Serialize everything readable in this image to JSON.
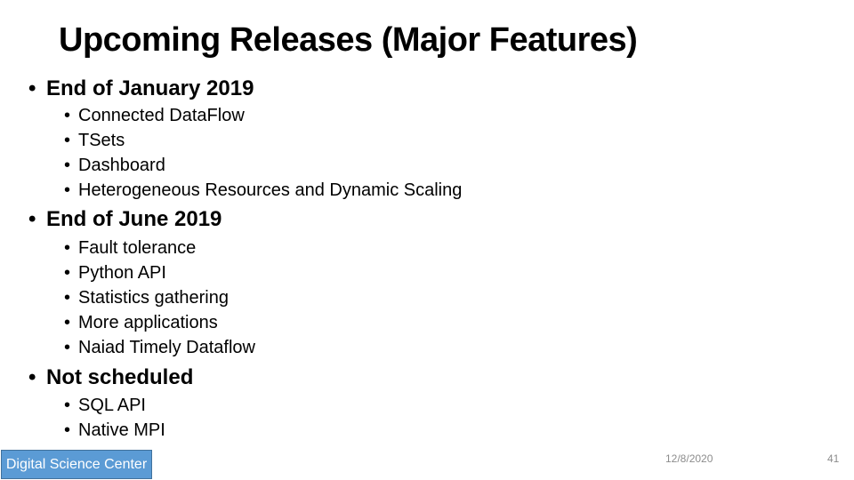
{
  "slide": {
    "title": "Upcoming Releases (Major Features)",
    "sections": [
      {
        "heading": "End of January 2019",
        "items": [
          "Connected DataFlow",
          "TSets",
          "Dashboard",
          "Heterogeneous Resources and Dynamic Scaling"
        ]
      },
      {
        "heading": "End of June 2019",
        "items": [
          "Fault tolerance",
          "Python API",
          "Statistics gathering",
          "More applications",
          "Naiad Timely Dataflow"
        ]
      },
      {
        "heading": "Not scheduled",
        "items": [
          "SQL API",
          "Native MPI"
        ]
      }
    ],
    "bullet_char": "•"
  },
  "footer": {
    "badge": "Digital Science Center",
    "badge_color": "#5b9bd5",
    "date": "12/8/2020",
    "page_number": "41"
  }
}
